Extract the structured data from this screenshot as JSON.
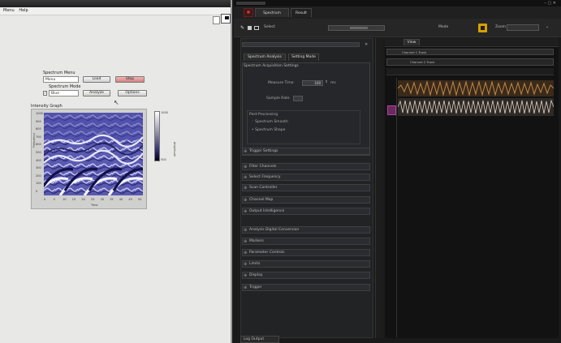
{
  "left_window": {
    "menu": [
      "Menu",
      "Help"
    ],
    "group_label_1": "Spectrum Menu",
    "field_1_value": "Menu",
    "group_label_2": "Spectrum Mode",
    "field_2_value": "Blue",
    "checkbox_checked": true,
    "buttons": [
      "Load",
      "Stop",
      "Analyze",
      "Options"
    ],
    "plot_title": "Intensity Graph",
    "x_axis_label": "Time",
    "y_axis_label": "Frequency",
    "colorbar_label": "Amplitude",
    "colorbar_ticks": [
      "1000",
      "500"
    ],
    "x_ticks": [
      "0",
      "5",
      "10",
      "15",
      "20",
      "25",
      "30",
      "35",
      "40",
      "45",
      "50"
    ],
    "y_ticks": [
      "1000",
      "900",
      "800",
      "700",
      "600",
      "500",
      "400",
      "300",
      "200",
      "100",
      "0"
    ],
    "colors": {
      "spectrogram_dark": "#1c1c70",
      "spectrogram_light": "#b8b8e8"
    }
  },
  "right_window": {
    "tabs": [
      "Spectrum",
      "Result"
    ],
    "toolbar": {
      "label": "Select",
      "mode_label": "Mode",
      "zoom_label": "Zoom"
    },
    "panel_tabs": [
      "Spectrum Analysis",
      "Setting Mode"
    ],
    "panel_header": "Spectrum Acquisition Settings",
    "row_time_label": "Measure Time",
    "row_time_value": "100",
    "row_unit": "ms",
    "row_delay_label": "Sample Rate",
    "subgroup_label": "Post-Processing",
    "radio_options": [
      "Spectrum Smooth",
      "Spectrum Shape"
    ],
    "sections": [
      "Trigger Settings",
      "Filter Channels",
      "Select Frequency",
      "Scan Controller",
      "Channel Map",
      "Output Intelligence",
      "Analysis Digital Conversion",
      "Markers",
      "Parameter Controls",
      "Limits",
      "Display",
      "Trigger"
    ],
    "timeline": {
      "header_tab": "View",
      "track_labels": [
        "Channel 1 Track",
        "Channel 2 Track"
      ]
    },
    "bottom_tab": "Log Output",
    "colors": {
      "accent_orange": "#d8a000",
      "accent_red": "#c03030",
      "waveform": "#b07a40"
    }
  }
}
